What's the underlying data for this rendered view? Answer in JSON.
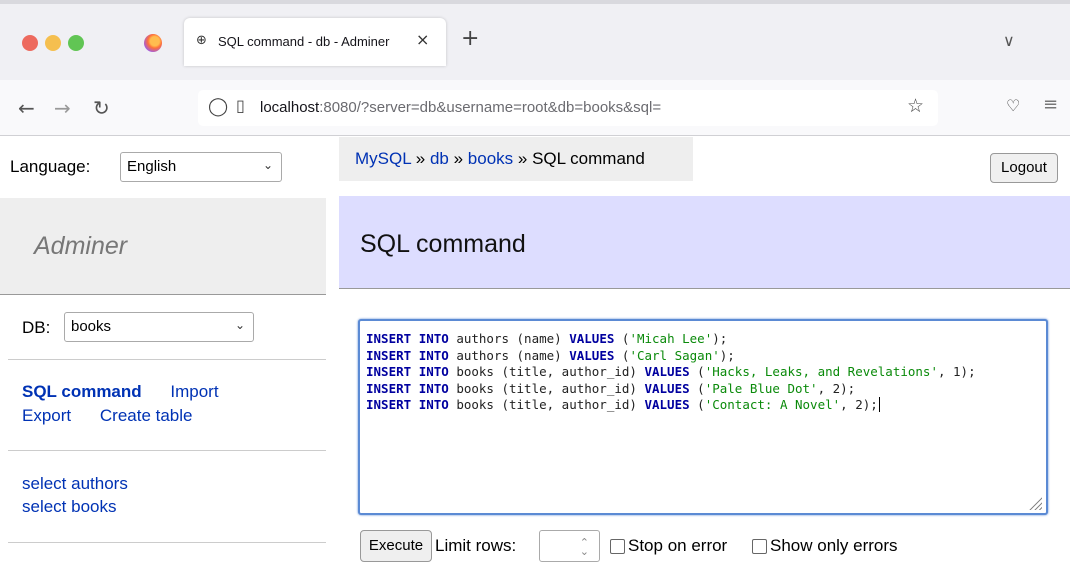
{
  "browser": {
    "tab_title": "SQL command - db - Adminer",
    "url_host": "localhost",
    "url_rest": ":8080/?server=db&username=root&db=books&sql=",
    "new_tab_glyph": "+",
    "close_glyph": "×",
    "tab_icon_glyph": "⊕"
  },
  "sidebar": {
    "language_label": "Language:",
    "language_value": "English",
    "brand": "Adminer",
    "db_label": "DB:",
    "db_value": "books",
    "links": {
      "sql_command": "SQL command",
      "import": "Import",
      "export": "Export",
      "create_table": "Create table"
    },
    "tables": [
      "select authors",
      "select books"
    ]
  },
  "breadcrumb": {
    "items": [
      "MySQL",
      "db",
      "books"
    ],
    "separator": " » ",
    "current": "SQL command"
  },
  "logout_label": "Logout",
  "content": {
    "title": "SQL command"
  },
  "sql": [
    [
      {
        "t": "kw",
        "v": "INSERT"
      },
      {
        "t": "p",
        "v": " "
      },
      {
        "t": "kw",
        "v": "INTO"
      },
      {
        "t": "p",
        "v": " authors (name) "
      },
      {
        "t": "kw",
        "v": "VALUES"
      },
      {
        "t": "p",
        "v": " ("
      },
      {
        "t": "str",
        "v": "'Micah Lee'"
      },
      {
        "t": "p",
        "v": ");"
      }
    ],
    [
      {
        "t": "kw",
        "v": "INSERT"
      },
      {
        "t": "p",
        "v": " "
      },
      {
        "t": "kw",
        "v": "INTO"
      },
      {
        "t": "p",
        "v": " authors (name) "
      },
      {
        "t": "kw",
        "v": "VALUES"
      },
      {
        "t": "p",
        "v": " ("
      },
      {
        "t": "str",
        "v": "'Carl Sagan'"
      },
      {
        "t": "p",
        "v": ");"
      }
    ],
    [
      {
        "t": "kw",
        "v": "INSERT"
      },
      {
        "t": "p",
        "v": " "
      },
      {
        "t": "kw",
        "v": "INTO"
      },
      {
        "t": "p",
        "v": " books (title, author_id) "
      },
      {
        "t": "kw",
        "v": "VALUES"
      },
      {
        "t": "p",
        "v": " ("
      },
      {
        "t": "str",
        "v": "'Hacks, Leaks, and Revelations'"
      },
      {
        "t": "p",
        "v": ", 1);"
      }
    ],
    [
      {
        "t": "kw",
        "v": "INSERT"
      },
      {
        "t": "p",
        "v": " "
      },
      {
        "t": "kw",
        "v": "INTO"
      },
      {
        "t": "p",
        "v": " books (title, author_id) "
      },
      {
        "t": "kw",
        "v": "VALUES"
      },
      {
        "t": "p",
        "v": " ("
      },
      {
        "t": "str",
        "v": "'Pale Blue Dot'"
      },
      {
        "t": "p",
        "v": ", 2);"
      }
    ],
    [
      {
        "t": "kw",
        "v": "INSERT"
      },
      {
        "t": "p",
        "v": " "
      },
      {
        "t": "kw",
        "v": "INTO"
      },
      {
        "t": "p",
        "v": " books (title, author_id) "
      },
      {
        "t": "kw",
        "v": "VALUES"
      },
      {
        "t": "p",
        "v": " ("
      },
      {
        "t": "str",
        "v": "'Contact: A Novel'"
      },
      {
        "t": "p",
        "v": ", 2);"
      }
    ]
  ],
  "controls": {
    "execute_label": "Execute",
    "limit_label": "Limit rows:",
    "limit_value": "",
    "stop_on_error": "Stop on error",
    "show_only_errors": "Show only errors"
  },
  "colors": {
    "link": "#0032b4",
    "keyword": "#00009f",
    "string": "#0a8a0a",
    "header_bg": "#ddf"
  }
}
